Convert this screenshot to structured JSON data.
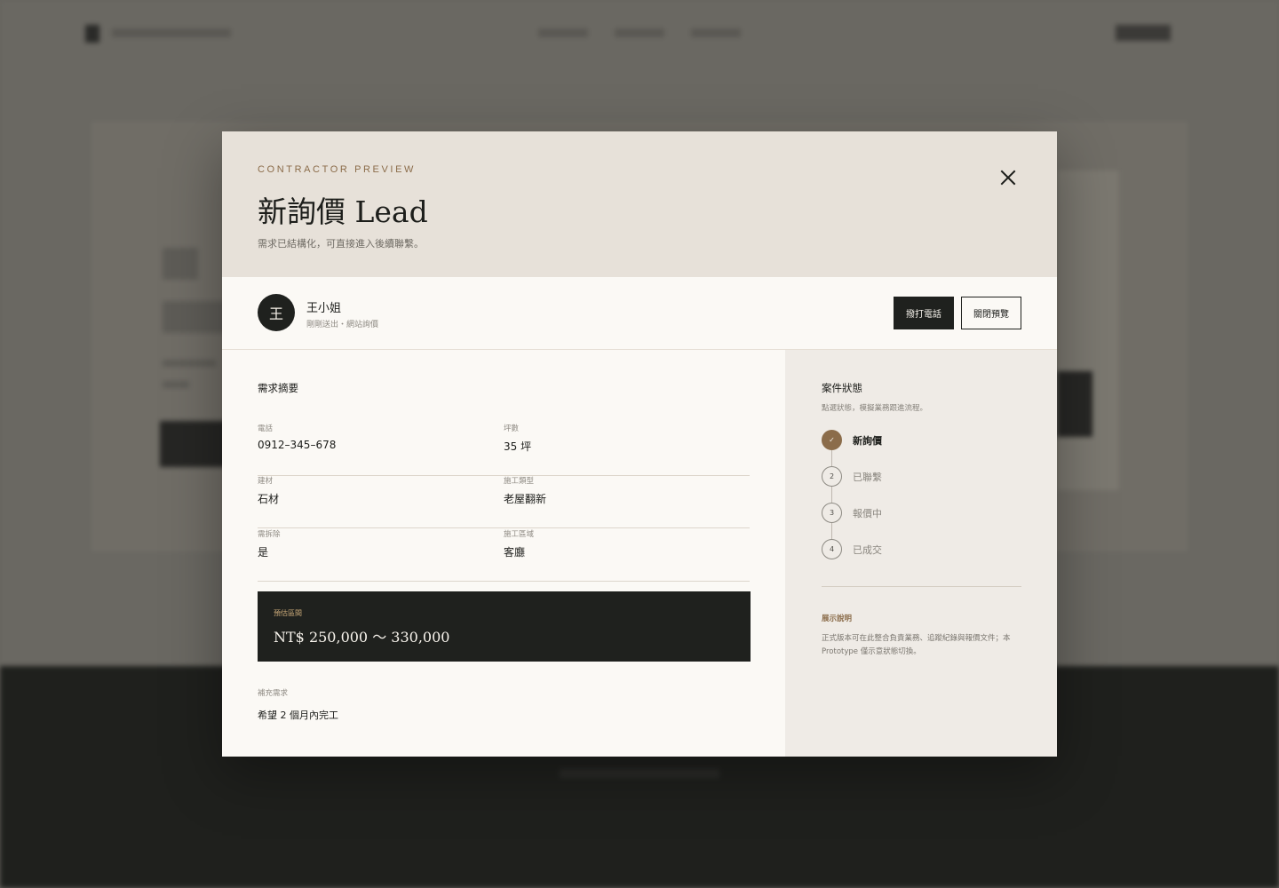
{
  "modal": {
    "eyebrow": "CONTRACTOR PREVIEW",
    "title": "新詢價 Lead",
    "subtitle": "需求已結構化，可直接進入後續聯繫。",
    "close_icon": "close-icon"
  },
  "client": {
    "avatar_initial": "王",
    "name": "王小姐",
    "meta": "剛剛送出・網站詢價",
    "call_button": "撥打電話",
    "close_preview_button": "關閉預覽"
  },
  "summary": {
    "title": "需求摘要",
    "fields": [
      {
        "label": "電話",
        "value": "0912–345–678"
      },
      {
        "label": "坪數",
        "value": "35 坪"
      },
      {
        "label": "建材",
        "value": "石材"
      },
      {
        "label": "施工類型",
        "value": "老屋翻新"
      },
      {
        "label": "需拆除",
        "value": "是"
      },
      {
        "label": "施工區域",
        "value": "客廳"
      }
    ],
    "estimate_label": "預估區間",
    "estimate_value": "NT$ 250,000 ～ 330,000",
    "extra_label": "補充需求",
    "extra_value": "希望 2 個月內完工"
  },
  "status": {
    "title": "案件狀態",
    "subtitle": "點選狀態，模擬業務跟進流程。",
    "steps": [
      {
        "marker": "✓",
        "label": "新詢價",
        "active": true
      },
      {
        "marker": "2",
        "label": "已聯繫",
        "active": false
      },
      {
        "marker": "3",
        "label": "報價中",
        "active": false
      },
      {
        "marker": "4",
        "label": "已成交",
        "active": false
      }
    ],
    "note_label": "展示說明",
    "note_text": "正式版本可在此整合負責業務、追蹤紀錄與報價文件；本 Prototype 僅示意狀態切換。"
  },
  "colors": {
    "accent": "#8b6c4a",
    "dark": "#1f211e",
    "header_bg": "#e7e1d9",
    "side_bg": "#efebe6"
  }
}
